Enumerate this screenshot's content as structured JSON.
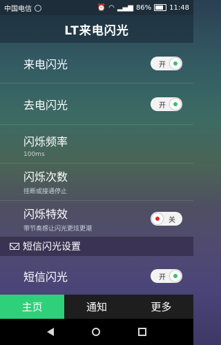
{
  "status_bar": {
    "carrier": "中国电信",
    "battery": "86%",
    "time": "11:48"
  },
  "app_title": "LT来电闪光",
  "settings": {
    "incoming_flash": {
      "label": "来电闪光",
      "toggle_text": "开",
      "on": true
    },
    "outgoing_flash": {
      "label": "去电闪光",
      "toggle_text": "开",
      "on": true
    },
    "frequency": {
      "label": "闪烁频率",
      "sub": "100ms"
    },
    "count": {
      "label": "闪烁次数",
      "sub": "挂断或接通停止"
    },
    "effect": {
      "label": "闪烁特效",
      "sub": "带节奏感让闪光更炫更潮",
      "toggle_text": "关",
      "on": false
    }
  },
  "sms_section": {
    "header": "短信闪光设置",
    "sms_flash": {
      "label": "短信闪光",
      "toggle_text": "开",
      "on": true
    }
  },
  "tabs": [
    {
      "label": "主页",
      "active": true
    },
    {
      "label": "通知",
      "active": false
    },
    {
      "label": "更多",
      "active": false
    }
  ],
  "colors": {
    "accent_green": "#2fd07a",
    "toggle_on_dot": "#3bbf6a",
    "toggle_off_dot": "#e0262b"
  },
  "icons": [
    "signal-icon",
    "wifi-icon",
    "alarm-icon",
    "battery-icon",
    "envelope-icon",
    "back-icon",
    "home-icon",
    "recent-apps-icon"
  ]
}
